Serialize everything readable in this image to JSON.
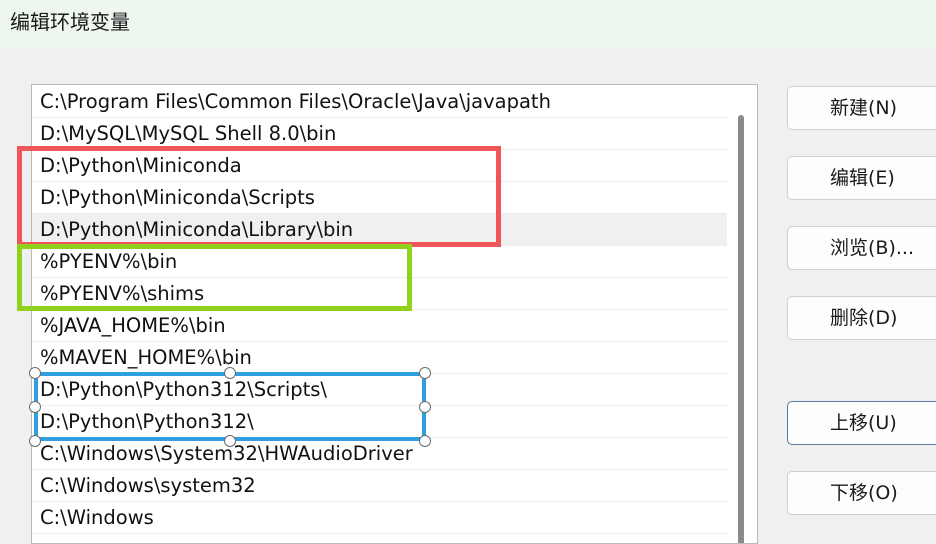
{
  "window": {
    "title": "编辑环境变量"
  },
  "path_list": {
    "items": [
      {
        "label": "C:\\Program Files\\Common Files\\Oracle\\Java\\javapath"
      },
      {
        "label": "D:\\MySQL\\MySQL Shell 8.0\\bin"
      },
      {
        "label": "D:\\Python\\Miniconda"
      },
      {
        "label": "D:\\Python\\Miniconda\\Scripts"
      },
      {
        "label": "D:\\Python\\Miniconda\\Library\\bin"
      },
      {
        "label": "%PYENV%\\bin"
      },
      {
        "label": "%PYENV%\\shims"
      },
      {
        "label": "%JAVA_HOME%\\bin"
      },
      {
        "label": "%MAVEN_HOME%\\bin"
      },
      {
        "label": "D:\\Python\\Python312\\Scripts\\"
      },
      {
        "label": "D:\\Python\\Python312\\"
      },
      {
        "label": "C:\\Windows\\System32\\HWAudioDriver"
      },
      {
        "label": "C:\\Windows\\system32"
      },
      {
        "label": "C:\\Windows"
      }
    ],
    "selected_item": "D:\\Python\\Miniconda\\Library\\bin"
  },
  "buttons": {
    "new": "新建(N)",
    "edit": "编辑(E)",
    "browse": "浏览(B)...",
    "delete": "删除(D)",
    "move_up": "上移(U)",
    "move_down": "下移(O)"
  },
  "annotations": {
    "red_color": "#f0555a",
    "green_color": "#8fd11e",
    "blue_color": "#2f9fdf"
  }
}
